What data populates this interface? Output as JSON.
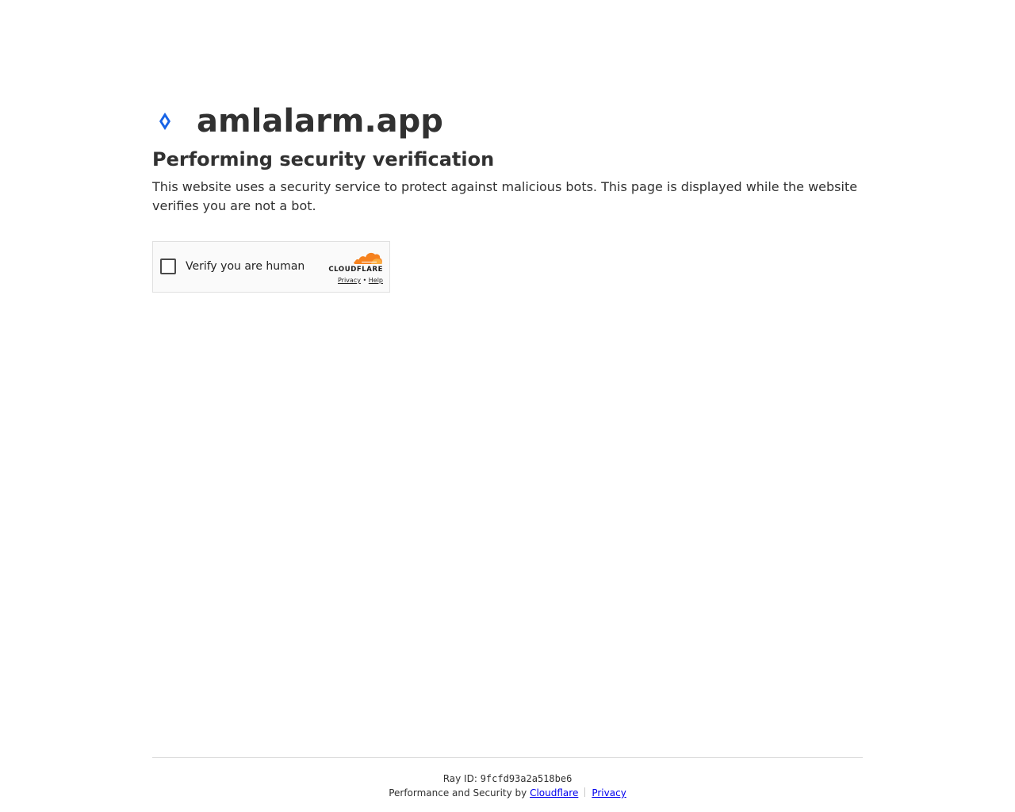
{
  "site": {
    "name": "amlalarm.app",
    "favicon_icon": "diamond-icon",
    "favicon_color": "#1763e6"
  },
  "heading": {
    "title": "Performing security verification",
    "description": "This website uses a security service to protect against malicious bots. This page is displayed while the website verifies you are not a bot."
  },
  "widget": {
    "checkbox_label": "Verify you are human",
    "checked": false,
    "brand": "CLOUDFLARE",
    "brand_icon": "cloud-icon",
    "brand_colors": [
      "#f6821f",
      "#fbad41"
    ],
    "privacy_link": "Privacy",
    "link_separator": "•",
    "help_link": "Help"
  },
  "footer": {
    "ray_label": "Ray ID:",
    "ray_id": "9fcfd93a2a518be6",
    "performance_text": "Performance and Security by",
    "cloudflare_link": "Cloudflare",
    "privacy_link": "Privacy"
  }
}
